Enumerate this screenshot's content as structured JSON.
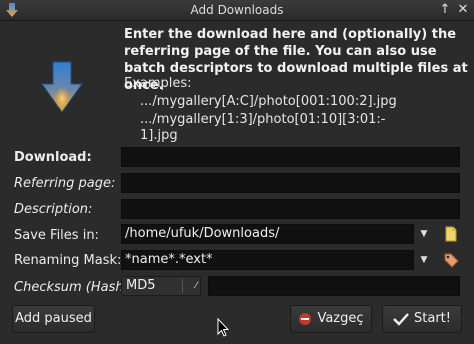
{
  "window": {
    "title": "Add Downloads"
  },
  "intro_text": "Enter the download here and (optionally) the referring page of the file. You can also use batch descriptors to download multiple files at once.",
  "examples": {
    "label": "Examples:",
    "line1": ".../mygallery[A:C]/photo[001:100:2].jpg",
    "line2": ".../mygallery[1:3]/photo[01:10][3:01:-",
    "line3": "1].jpg"
  },
  "form": {
    "download_label": "Download:",
    "download_value": "",
    "referring_label": "Referring page:",
    "referring_value": "",
    "description_label": "Description:",
    "description_value": "",
    "save_label": "Save Files in:",
    "save_value": "/home/ufuk/Downloads/",
    "renaming_label": "Renaming Mask:",
    "renaming_value": "*name*.*ext*",
    "checksum_label": "Checksum (Hash):",
    "checksum_type": "MD5",
    "checksum_value": ""
  },
  "buttons": {
    "add_paused": "Add paused",
    "cancel": "Vazgeç",
    "start": "Start!"
  },
  "icons": {
    "titlebar": "download-arrow-icon",
    "big": "download-arrow-icon",
    "save_browse": "folder-icon",
    "renaming_tag": "tag-icon",
    "cancel": "cancel-icon",
    "start": "checkmark-icon"
  },
  "colors": {
    "window_bg": "#2b2b2b",
    "field_bg": "#111111",
    "arrow_blue": "#2f7fd1",
    "arrow_orange": "#f5a623"
  }
}
